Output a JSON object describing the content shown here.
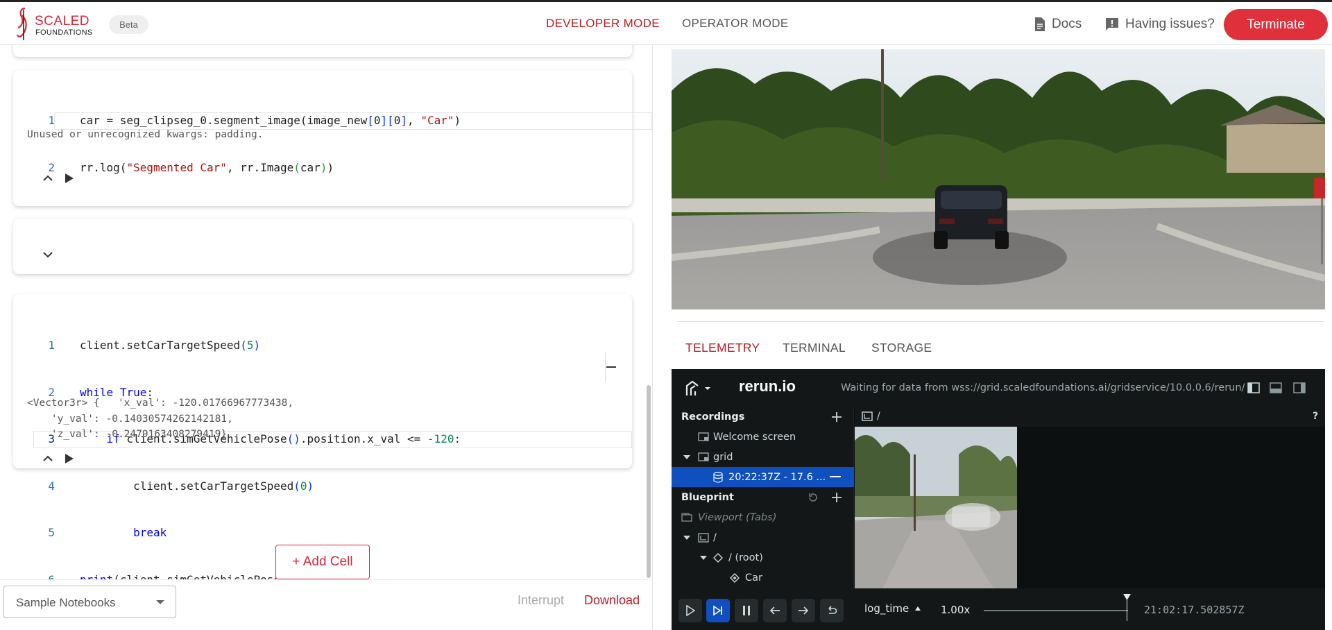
{
  "header": {
    "brand_line1": "SCALED",
    "brand_line2": "FOUNDATIONS",
    "beta": "Beta",
    "mode_developer": "DEVELOPER MODE",
    "mode_operator": "OPERATOR MODE",
    "docs": "Docs",
    "issues": "Having issues?",
    "terminate": "Terminate",
    "colors": {
      "accent": "#e0303c",
      "active_mode": "#b71c24"
    }
  },
  "notebook": {
    "cell1": {
      "lines": [
        {
          "n": "1",
          "code": "car = seg_clipseg_0.segment_image(image_new[0][0], \"Car\")"
        },
        {
          "n": "2",
          "code": "rr.log(\"Segmented Car\", rr.Image(car))"
        }
      ],
      "output": "Unused or unrecognized kwargs: padding."
    },
    "cell3": {
      "lines": [
        {
          "n": "1",
          "code": "client.setCarTargetSpeed(5)"
        },
        {
          "n": "2",
          "code": "while True:"
        },
        {
          "n": "3",
          "code": "    if client.simGetVehiclePose().position.x_val <= -120:"
        },
        {
          "n": "4",
          "code": "        client.setCarTargetSpeed(0)"
        },
        {
          "n": "5",
          "code": "        break"
        },
        {
          "n": "6",
          "code": "print(client.simGetVehiclePose().position)"
        }
      ],
      "output_lines": [
        "<Vector3r> {   'x_val': -120.01766967773438,",
        "    'y_val': -0.14030574262142181,",
        "    'z_val': -0.2479163408279419}"
      ]
    },
    "add_cell": "+ Add Cell",
    "sample_notebooks": "Sample Notebooks",
    "interrupt": "Interrupt",
    "download": "Download"
  },
  "right_tabs": [
    "TELEMETRY",
    "TERMINAL",
    "STORAGE"
  ],
  "rerun": {
    "brand": "rerun.io",
    "waiting": "Waiting for data from wss://grid.scaledfoundations.ai/gridservice/10.0.0.6/rerun/",
    "recordings_label": "Recordings",
    "welcome": "Welcome screen",
    "grid": "grid",
    "recording": "20:22:37Z - 17.6 ...",
    "blueprint_label": "Blueprint",
    "viewport": "Viewport (Tabs)",
    "root_space": "/",
    "root_entity": "/ (root)",
    "car_entity": "Car",
    "view_path": "/",
    "help": "?",
    "timeline": "log_time",
    "speed": "1.00x",
    "current_time": "21:02:17.502857Z"
  }
}
